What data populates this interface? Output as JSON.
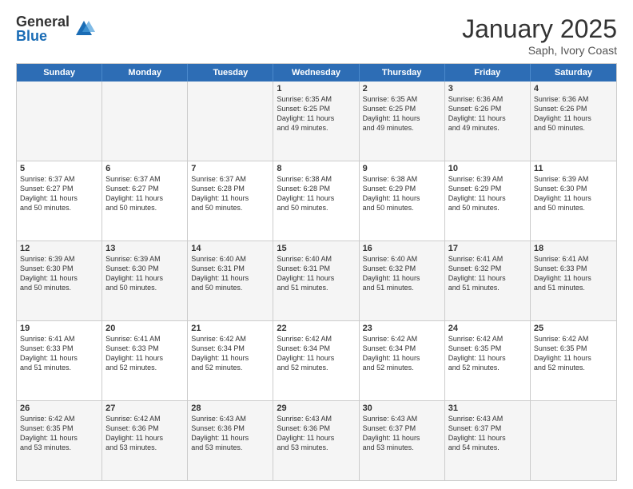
{
  "logo": {
    "general": "General",
    "blue": "Blue"
  },
  "header": {
    "month": "January 2025",
    "location": "Saph, Ivory Coast"
  },
  "days": [
    "Sunday",
    "Monday",
    "Tuesday",
    "Wednesday",
    "Thursday",
    "Friday",
    "Saturday"
  ],
  "rows": [
    [
      {
        "num": "",
        "text": ""
      },
      {
        "num": "",
        "text": ""
      },
      {
        "num": "",
        "text": ""
      },
      {
        "num": "1",
        "text": "Sunrise: 6:35 AM\nSunset: 6:25 PM\nDaylight: 11 hours\nand 49 minutes."
      },
      {
        "num": "2",
        "text": "Sunrise: 6:35 AM\nSunset: 6:25 PM\nDaylight: 11 hours\nand 49 minutes."
      },
      {
        "num": "3",
        "text": "Sunrise: 6:36 AM\nSunset: 6:26 PM\nDaylight: 11 hours\nand 49 minutes."
      },
      {
        "num": "4",
        "text": "Sunrise: 6:36 AM\nSunset: 6:26 PM\nDaylight: 11 hours\nand 50 minutes."
      }
    ],
    [
      {
        "num": "5",
        "text": "Sunrise: 6:37 AM\nSunset: 6:27 PM\nDaylight: 11 hours\nand 50 minutes."
      },
      {
        "num": "6",
        "text": "Sunrise: 6:37 AM\nSunset: 6:27 PM\nDaylight: 11 hours\nand 50 minutes."
      },
      {
        "num": "7",
        "text": "Sunrise: 6:37 AM\nSunset: 6:28 PM\nDaylight: 11 hours\nand 50 minutes."
      },
      {
        "num": "8",
        "text": "Sunrise: 6:38 AM\nSunset: 6:28 PM\nDaylight: 11 hours\nand 50 minutes."
      },
      {
        "num": "9",
        "text": "Sunrise: 6:38 AM\nSunset: 6:29 PM\nDaylight: 11 hours\nand 50 minutes."
      },
      {
        "num": "10",
        "text": "Sunrise: 6:39 AM\nSunset: 6:29 PM\nDaylight: 11 hours\nand 50 minutes."
      },
      {
        "num": "11",
        "text": "Sunrise: 6:39 AM\nSunset: 6:30 PM\nDaylight: 11 hours\nand 50 minutes."
      }
    ],
    [
      {
        "num": "12",
        "text": "Sunrise: 6:39 AM\nSunset: 6:30 PM\nDaylight: 11 hours\nand 50 minutes."
      },
      {
        "num": "13",
        "text": "Sunrise: 6:39 AM\nSunset: 6:30 PM\nDaylight: 11 hours\nand 50 minutes."
      },
      {
        "num": "14",
        "text": "Sunrise: 6:40 AM\nSunset: 6:31 PM\nDaylight: 11 hours\nand 50 minutes."
      },
      {
        "num": "15",
        "text": "Sunrise: 6:40 AM\nSunset: 6:31 PM\nDaylight: 11 hours\nand 51 minutes."
      },
      {
        "num": "16",
        "text": "Sunrise: 6:40 AM\nSunset: 6:32 PM\nDaylight: 11 hours\nand 51 minutes."
      },
      {
        "num": "17",
        "text": "Sunrise: 6:41 AM\nSunset: 6:32 PM\nDaylight: 11 hours\nand 51 minutes."
      },
      {
        "num": "18",
        "text": "Sunrise: 6:41 AM\nSunset: 6:33 PM\nDaylight: 11 hours\nand 51 minutes."
      }
    ],
    [
      {
        "num": "19",
        "text": "Sunrise: 6:41 AM\nSunset: 6:33 PM\nDaylight: 11 hours\nand 51 minutes."
      },
      {
        "num": "20",
        "text": "Sunrise: 6:41 AM\nSunset: 6:33 PM\nDaylight: 11 hours\nand 52 minutes."
      },
      {
        "num": "21",
        "text": "Sunrise: 6:42 AM\nSunset: 6:34 PM\nDaylight: 11 hours\nand 52 minutes."
      },
      {
        "num": "22",
        "text": "Sunrise: 6:42 AM\nSunset: 6:34 PM\nDaylight: 11 hours\nand 52 minutes."
      },
      {
        "num": "23",
        "text": "Sunrise: 6:42 AM\nSunset: 6:34 PM\nDaylight: 11 hours\nand 52 minutes."
      },
      {
        "num": "24",
        "text": "Sunrise: 6:42 AM\nSunset: 6:35 PM\nDaylight: 11 hours\nand 52 minutes."
      },
      {
        "num": "25",
        "text": "Sunrise: 6:42 AM\nSunset: 6:35 PM\nDaylight: 11 hours\nand 52 minutes."
      }
    ],
    [
      {
        "num": "26",
        "text": "Sunrise: 6:42 AM\nSunset: 6:35 PM\nDaylight: 11 hours\nand 53 minutes."
      },
      {
        "num": "27",
        "text": "Sunrise: 6:42 AM\nSunset: 6:36 PM\nDaylight: 11 hours\nand 53 minutes."
      },
      {
        "num": "28",
        "text": "Sunrise: 6:43 AM\nSunset: 6:36 PM\nDaylight: 11 hours\nand 53 minutes."
      },
      {
        "num": "29",
        "text": "Sunrise: 6:43 AM\nSunset: 6:36 PM\nDaylight: 11 hours\nand 53 minutes."
      },
      {
        "num": "30",
        "text": "Sunrise: 6:43 AM\nSunset: 6:37 PM\nDaylight: 11 hours\nand 53 minutes."
      },
      {
        "num": "31",
        "text": "Sunrise: 6:43 AM\nSunset: 6:37 PM\nDaylight: 11 hours\nand 54 minutes."
      },
      {
        "num": "",
        "text": ""
      }
    ]
  ]
}
